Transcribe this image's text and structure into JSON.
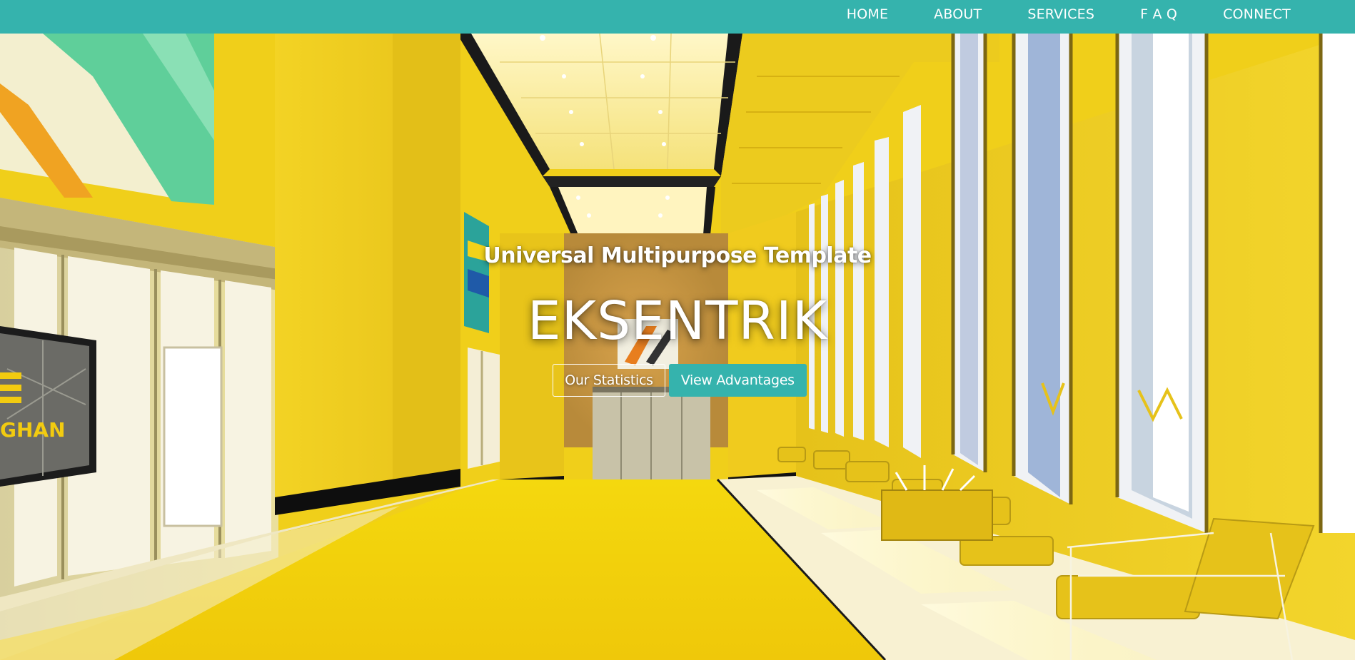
{
  "nav": {
    "items": [
      {
        "label": "HOME"
      },
      {
        "label": "ABOUT"
      },
      {
        "label": "SERVICES"
      },
      {
        "label": "F A Q"
      },
      {
        "label": "CONNECT"
      }
    ]
  },
  "hero": {
    "subtitle": "Universal Multipurpose Template",
    "title": "EKSENTRIK",
    "buttons": {
      "statistics_label": "Our Statistics",
      "advantages_label": "View Advantages"
    },
    "poster_text": "GHAN"
  },
  "colors": {
    "accent": "#35b3ad",
    "hero_yellow": "#f2d21a",
    "text": "#ffffff"
  }
}
